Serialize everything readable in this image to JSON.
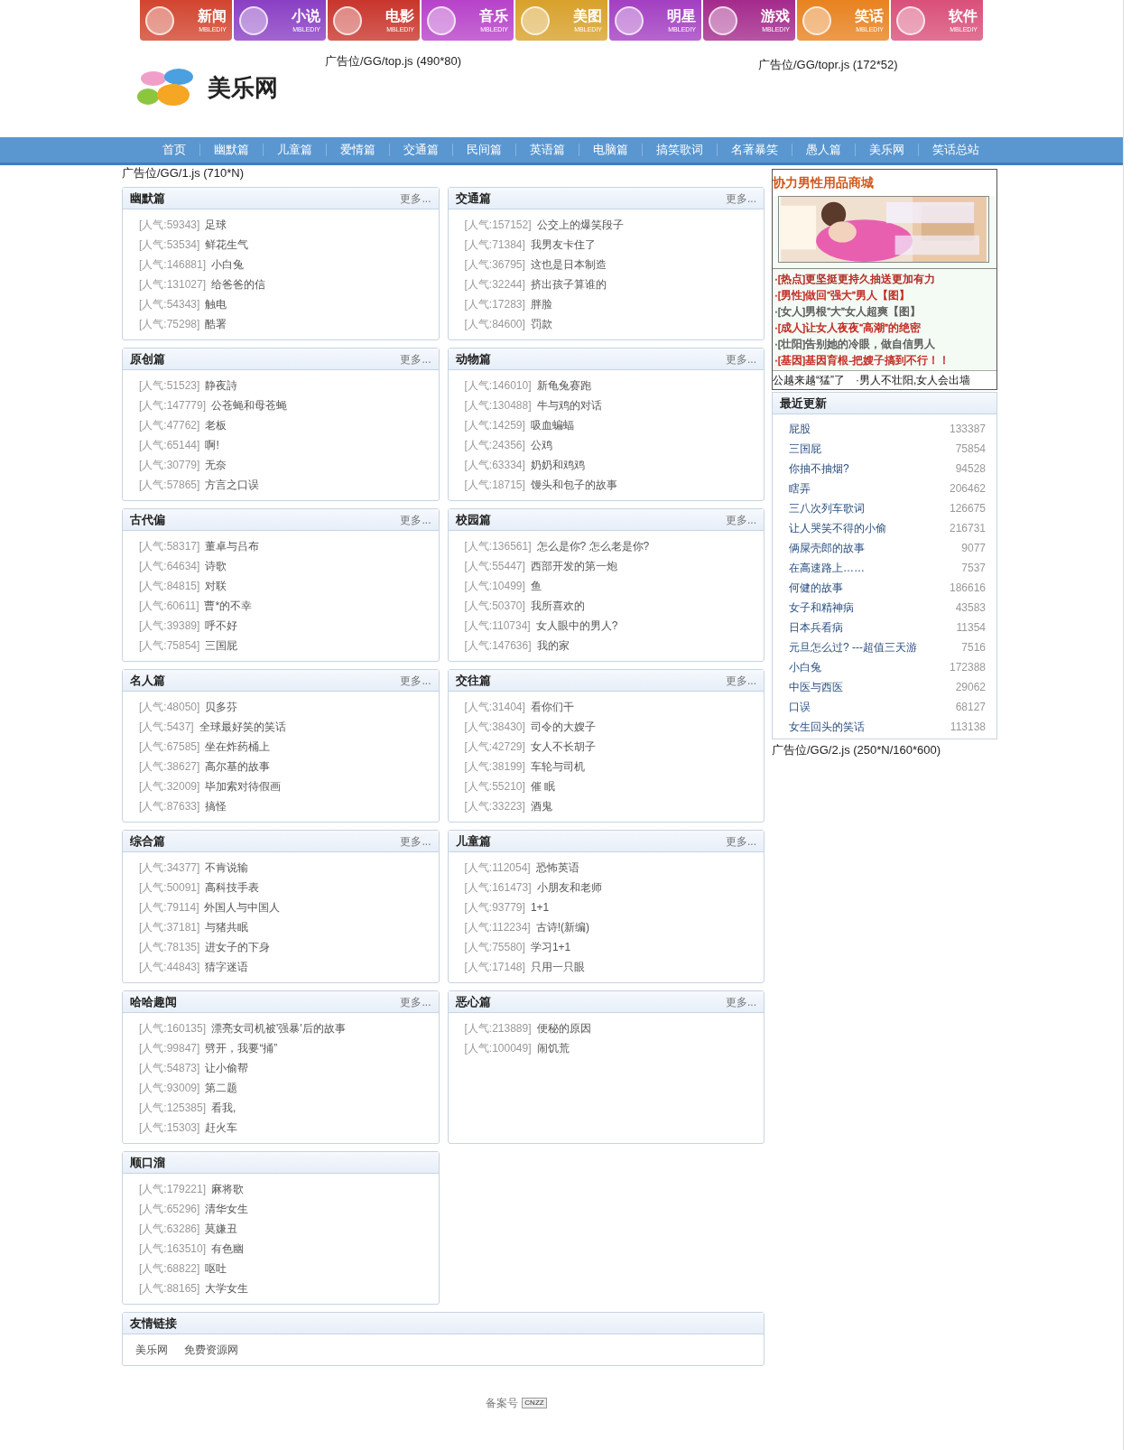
{
  "top_nav": [
    {
      "label": "新闻",
      "sub": "MBLEDIY",
      "color": "#d2452f"
    },
    {
      "label": "小说",
      "sub": "MBLEDIY",
      "color": "#8a3fc4"
    },
    {
      "label": "电影",
      "sub": "MBLEDIY",
      "color": "#c8352c"
    },
    {
      "label": "音乐",
      "sub": "MBLEDIY",
      "color": "#b742c9"
    },
    {
      "label": "美图",
      "sub": "MBLEDIY",
      "color": "#d8a12b"
    },
    {
      "label": "明星",
      "sub": "MBLEDIY",
      "color": "#a33fc2"
    },
    {
      "label": "游戏",
      "sub": "MBLEDIY",
      "color": "#a42a8c"
    },
    {
      "label": "笑话",
      "sub": "MBLEDIY",
      "color": "#e8821f"
    },
    {
      "label": "软件",
      "sub": "MBLEDIY",
      "color": "#d9507a"
    }
  ],
  "logo": {
    "text": "美乐网"
  },
  "header_ads": [
    "广告位/GG/top.js (490*80)",
    "广告位/GG/topr.js (172*52)"
  ],
  "menu": [
    "首页",
    "幽默篇",
    "儿童篇",
    "爱情篇",
    "交通篇",
    "民间篇",
    "英语篇",
    "电脑篇",
    "搞笑歌词",
    "名著暴笑",
    "愚人篇",
    "美乐网",
    "笑话总站"
  ],
  "main_ad": "广告位/GG/1.js (710*N)",
  "sections": [
    {
      "title": "幽默篇",
      "more": "更多...",
      "items": [
        {
          "hits": "[人气:59343]",
          "title": "足球"
        },
        {
          "hits": "[人气:53534]",
          "title": "鲜花生气"
        },
        {
          "hits": "[人气:146881]",
          "title": "小白兔"
        },
        {
          "hits": "[人气:131027]",
          "title": "给爸爸的信"
        },
        {
          "hits": "[人气:54343]",
          "title": "触电"
        },
        {
          "hits": "[人气:75298]",
          "title": "酷署"
        }
      ]
    },
    {
      "title": "交通篇",
      "more": "更多...",
      "items": [
        {
          "hits": "[人气:157152]",
          "title": "公交上的爆笑段子"
        },
        {
          "hits": "[人气:71384]",
          "title": "我男友卡住了"
        },
        {
          "hits": "[人气:36795]",
          "title": "这也是日本制造"
        },
        {
          "hits": "[人气:32244]",
          "title": "挤出孩子算谁的"
        },
        {
          "hits": "[人气:17283]",
          "title": "胖脸"
        },
        {
          "hits": "[人气:84600]",
          "title": "罚款"
        }
      ]
    },
    {
      "title": "原创篇",
      "more": "更多...",
      "items": [
        {
          "hits": "[人气:51523]",
          "title": "静夜詩"
        },
        {
          "hits": "[人气:147779]",
          "title": "公苍蝇和母苍蝇"
        },
        {
          "hits": "[人气:47762]",
          "title": "老板"
        },
        {
          "hits": "[人气:65144]",
          "title": "啊!"
        },
        {
          "hits": "[人气:30779]",
          "title": "无奈"
        },
        {
          "hits": "[人气:57865]",
          "title": "方言之口误"
        }
      ]
    },
    {
      "title": "动物篇",
      "more": "更多...",
      "items": [
        {
          "hits": "[人气:146010]",
          "title": "新龟兔赛跑"
        },
        {
          "hits": "[人气:130488]",
          "title": "牛与鸡的对话"
        },
        {
          "hits": "[人气:14259]",
          "title": "吸血蝙蝠"
        },
        {
          "hits": "[人气:24356]",
          "title": "公鸡"
        },
        {
          "hits": "[人气:63334]",
          "title": "奶奶和鸡鸡"
        },
        {
          "hits": "[人气:18715]",
          "title": "馒头和包子的故事"
        }
      ]
    },
    {
      "title": "古代偏",
      "more": "更多...",
      "items": [
        {
          "hits": "[人气:58317]",
          "title": "董卓与吕布"
        },
        {
          "hits": "[人气:64634]",
          "title": "诗歌"
        },
        {
          "hits": "[人气:84815]",
          "title": "对联"
        },
        {
          "hits": "[人气:60611]",
          "title": "曹*的不幸"
        },
        {
          "hits": "[人气:39389]",
          "title": "呼不好"
        },
        {
          "hits": "[人气:75854]",
          "title": "三国屁"
        }
      ]
    },
    {
      "title": "校园篇",
      "more": "更多...",
      "items": [
        {
          "hits": "[人气:136561]",
          "title": "怎么是你? 怎么老是你?"
        },
        {
          "hits": "[人气:55447]",
          "title": "西部开发的第一炮"
        },
        {
          "hits": "[人气:10499]",
          "title": "鱼"
        },
        {
          "hits": "[人气:50370]",
          "title": "我所喜欢的"
        },
        {
          "hits": "[人气:110734]",
          "title": "女人眼中的男人?"
        },
        {
          "hits": "[人气:147636]",
          "title": "我的家"
        }
      ]
    },
    {
      "title": "名人篇",
      "more": "更多...",
      "items": [
        {
          "hits": "[人气:48050]",
          "title": "贝多芬"
        },
        {
          "hits": "[人气:5437]",
          "title": "全球最好笑的笑话"
        },
        {
          "hits": "[人气:67585]",
          "title": "坐在炸药桶上"
        },
        {
          "hits": "[人气:38627]",
          "title": "高尔基的故事"
        },
        {
          "hits": "[人气:32009]",
          "title": "毕加索对待假画"
        },
        {
          "hits": "[人气:87633]",
          "title": "搞怪"
        }
      ]
    },
    {
      "title": "交往篇",
      "more": "更多...",
      "items": [
        {
          "hits": "[人气:31404]",
          "title": "看你们干"
        },
        {
          "hits": "[人气:38430]",
          "title": "司令的大嫂子"
        },
        {
          "hits": "[人气:42729]",
          "title": "女人不长胡子"
        },
        {
          "hits": "[人气:38199]",
          "title": "车轮与司机"
        },
        {
          "hits": "[人气:55210]",
          "title": "催 眠"
        },
        {
          "hits": "[人气:33223]",
          "title": "酒鬼"
        }
      ]
    },
    {
      "title": "综合篇",
      "more": "更多...",
      "items": [
        {
          "hits": "[人气:34377]",
          "title": "不肯说输"
        },
        {
          "hits": "[人气:50091]",
          "title": "高科技手表"
        },
        {
          "hits": "[人气:79114]",
          "title": "外国人与中国人"
        },
        {
          "hits": "[人气:37181]",
          "title": "与猪共眠"
        },
        {
          "hits": "[人气:78135]",
          "title": "进女子的下身"
        },
        {
          "hits": "[人气:44843]",
          "title": "猜字迷语"
        }
      ]
    },
    {
      "title": "儿童篇",
      "more": "更多...",
      "items": [
        {
          "hits": "[人气:112054]",
          "title": "恐怖英语"
        },
        {
          "hits": "[人气:161473]",
          "title": "小朋友和老师"
        },
        {
          "hits": "[人气:93779]",
          "title": "1+1"
        },
        {
          "hits": "[人气:112234]",
          "title": "古诗!(新编)"
        },
        {
          "hits": "[人气:75580]",
          "title": "学习1+1"
        },
        {
          "hits": "[人气:17148]",
          "title": "只用一只眼"
        }
      ]
    },
    {
      "title": "哈哈趣闻",
      "more": "更多...",
      "items": [
        {
          "hits": "[人气:160135]",
          "title": "漂亮女司机被'强暴'后的故事"
        },
        {
          "hits": "[人气:99847]",
          "title": "劈开，我要“捅”"
        },
        {
          "hits": "[人气:54873]",
          "title": "让小偷帮"
        },
        {
          "hits": "[人气:93009]",
          "title": "第二题"
        },
        {
          "hits": "[人气:125385]",
          "title": "看我,"
        },
        {
          "hits": "[人气:15303]",
          "title": "赶火车"
        }
      ]
    },
    {
      "title": "恶心篇",
      "more": "更多...",
      "items": [
        {
          "hits": "[人气:213889]",
          "title": "便秘的原因"
        },
        {
          "hits": "[人气:100049]",
          "title": "闹饥荒"
        }
      ]
    },
    {
      "title": "顺口溜",
      "items": [
        {
          "hits": "[人气:179221]",
          "title": "麻将歌"
        },
        {
          "hits": "[人气:65296]",
          "title": "清华女生"
        },
        {
          "hits": "[人气:63286]",
          "title": "莫嫌丑"
        },
        {
          "hits": "[人气:163510]",
          "title": "有色幽"
        },
        {
          "hits": "[人气:68822]",
          "title": "呕吐"
        },
        {
          "hits": "[人气:88165]",
          "title": "大学女生"
        }
      ]
    }
  ],
  "friend_links": {
    "title": "友情链接",
    "links": [
      "美乐网",
      "免费资源网"
    ]
  },
  "sidebar": {
    "ad": {
      "title": "协力男性用品商城",
      "links": [
        {
          "text": "·[热点]更坚挺更持久抽送更加有力",
          "color": "#b0201a"
        },
        {
          "text": "·[男性]做回“强大”男人【图】",
          "color": "#c0221a"
        },
        {
          "text": "·[女人]男根“大”女人超爽【图】",
          "color": "#555555"
        },
        {
          "text": "·[成人]让女人夜夜“高潮”的绝密",
          "color": "#c0221a"
        },
        {
          "text": "·[壮阳]告别她的冷眼，做自信男人",
          "color": "#555555"
        },
        {
          "text": "·[基因]基因育根-把嫂子搞到不行！！",
          "color": "#c0221a"
        }
      ],
      "ticker": "公越来越“猛”了　·男人不壮阳,女人会出墙"
    },
    "recent": {
      "title": "最近更新",
      "items": [
        {
          "title": "屁股",
          "count": "133387"
        },
        {
          "title": "三国屁",
          "count": "75854"
        },
        {
          "title": "你抽不抽烟?",
          "count": "94528"
        },
        {
          "title": "瞎弄",
          "count": "206462"
        },
        {
          "title": "三八次列车歌词",
          "count": "126675"
        },
        {
          "title": "让人哭笑不得的小偷",
          "count": "216731"
        },
        {
          "title": "俩屎壳郎的故事",
          "count": "9077"
        },
        {
          "title": "在高速路上……",
          "count": "7537"
        },
        {
          "title": "何健的故事",
          "count": "186616"
        },
        {
          "title": "女子和精神病",
          "count": "43583"
        },
        {
          "title": "日本兵看病",
          "count": "11354"
        },
        {
          "title": "元旦怎么过? ---超值三天游",
          "count": "7516"
        },
        {
          "title": "小白兔",
          "count": "172388"
        },
        {
          "title": "中医与西医",
          "count": "29062"
        },
        {
          "title": "口误",
          "count": "68127"
        },
        {
          "title": "女生回头的笑话",
          "count": "113138"
        }
      ]
    },
    "ad_below": "广告位/GG/2.js (250*N/160*600)"
  },
  "footer": {
    "text": "备案号",
    "badge": "CNZZ"
  }
}
